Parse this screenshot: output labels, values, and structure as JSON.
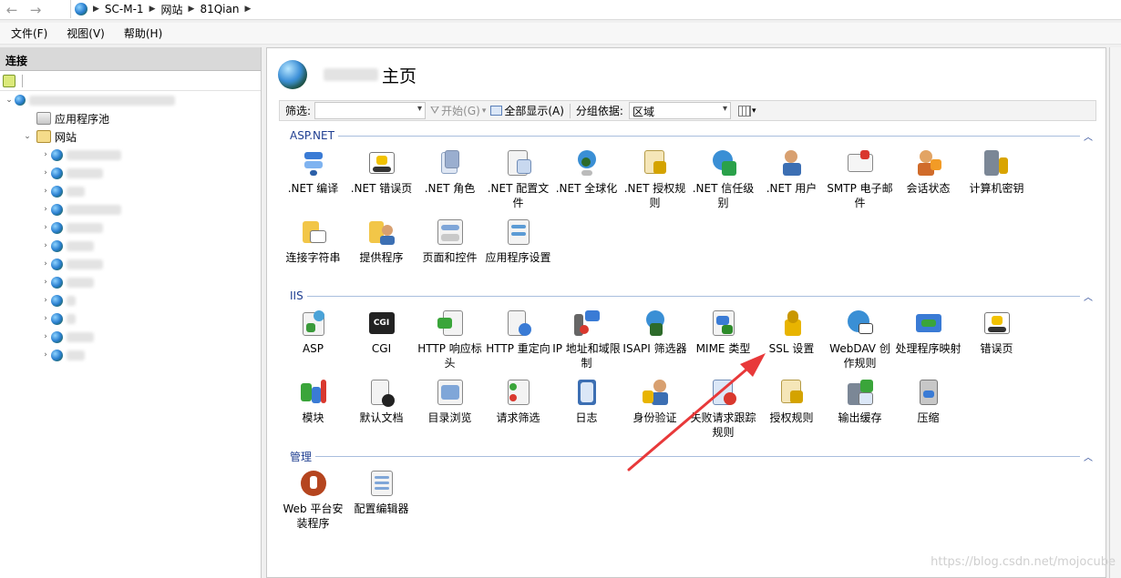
{
  "address": {
    "crumbs": [
      "SC-M-1",
      "网站",
      "81Qian"
    ]
  },
  "menu": [
    "文件(F)",
    "视图(V)",
    "帮助(H)"
  ],
  "left": {
    "title": "连接",
    "tree": {
      "app_pool": "应用程序池",
      "sites": "网站"
    }
  },
  "main": {
    "title": "主页",
    "filter": {
      "label": "筛选:",
      "start": "开始(G)",
      "show_all": "全部显示(A)",
      "group_by": "分组依据:",
      "group_value": "区域"
    },
    "groups": [
      {
        "name": "ASP.NET",
        "items": [
          {
            "label": ".NET 编译",
            "icon": "dotnet-compile-icon"
          },
          {
            "label": ".NET 错误页",
            "icon": "dotnet-error-page-icon"
          },
          {
            "label": ".NET 角色",
            "icon": "dotnet-roles-icon"
          },
          {
            "label": ".NET 配置文件",
            "icon": "dotnet-profile-icon"
          },
          {
            "label": ".NET 全球化",
            "icon": "dotnet-globalization-icon"
          },
          {
            "label": ".NET 授权规则",
            "icon": "dotnet-authorization-icon"
          },
          {
            "label": ".NET 信任级别",
            "icon": "dotnet-trust-icon"
          },
          {
            "label": ".NET 用户",
            "icon": "dotnet-users-icon"
          },
          {
            "label": "SMTP 电子邮件",
            "icon": "smtp-email-icon"
          },
          {
            "label": "会话状态",
            "icon": "session-state-icon"
          },
          {
            "label": "计算机密钥",
            "icon": "machine-key-icon"
          },
          {
            "label": "连接字符串",
            "icon": "connection-strings-icon"
          },
          {
            "label": "提供程序",
            "icon": "providers-icon"
          },
          {
            "label": "页面和控件",
            "icon": "pages-controls-icon"
          },
          {
            "label": "应用程序设置",
            "icon": "app-settings-icon"
          }
        ]
      },
      {
        "name": "IIS",
        "items": [
          {
            "label": "ASP",
            "icon": "asp-icon"
          },
          {
            "label": "CGI",
            "icon": "cgi-icon"
          },
          {
            "label": "HTTP 响应标头",
            "icon": "http-response-headers-icon"
          },
          {
            "label": "HTTP 重定向",
            "icon": "http-redirect-icon"
          },
          {
            "label": "IP 地址和域限制",
            "icon": "ip-domain-restrictions-icon"
          },
          {
            "label": "ISAPI 筛选器",
            "icon": "isapi-filters-icon"
          },
          {
            "label": "MIME 类型",
            "icon": "mime-types-icon"
          },
          {
            "label": "SSL 设置",
            "icon": "ssl-settings-icon"
          },
          {
            "label": "WebDAV 创作规则",
            "icon": "webdav-icon"
          },
          {
            "label": "处理程序映射",
            "icon": "handler-mappings-icon"
          },
          {
            "label": "错误页",
            "icon": "error-pages-icon"
          },
          {
            "label": "模块",
            "icon": "modules-icon"
          },
          {
            "label": "默认文档",
            "icon": "default-document-icon"
          },
          {
            "label": "目录浏览",
            "icon": "directory-browsing-icon"
          },
          {
            "label": "请求筛选",
            "icon": "request-filtering-icon"
          },
          {
            "label": "日志",
            "icon": "logging-icon"
          },
          {
            "label": "身份验证",
            "icon": "authentication-icon"
          },
          {
            "label": "失败请求跟踪规则",
            "icon": "failed-request-tracing-icon"
          },
          {
            "label": "授权规则",
            "icon": "authorization-rules-icon"
          },
          {
            "label": "输出缓存",
            "icon": "output-caching-icon"
          },
          {
            "label": "压缩",
            "icon": "compression-icon"
          }
        ]
      },
      {
        "name": "管理",
        "items": [
          {
            "label": "Web 平台安装程序",
            "icon": "web-platform-installer-icon"
          },
          {
            "label": "配置编辑器",
            "icon": "configuration-editor-icon"
          }
        ]
      }
    ]
  },
  "watermark": "https://blog.csdn.net/mojocube",
  "colors": {
    "accent": "#1f3e91",
    "arrow": "#e8393a"
  }
}
